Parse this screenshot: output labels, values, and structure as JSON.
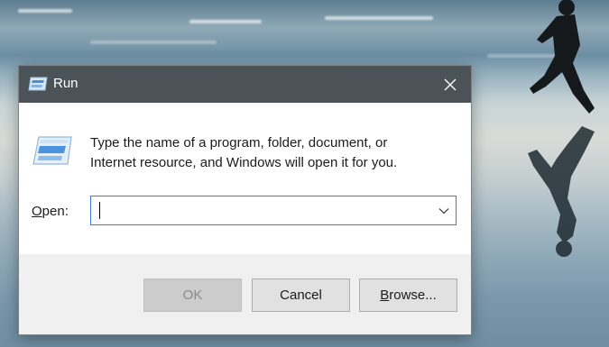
{
  "dialog": {
    "title": "Run",
    "description_line1": "Type the name of a program, folder, document, or",
    "description_line2": "Internet resource, and Windows will open it for you.",
    "open_label_mnemonic": "O",
    "open_label_rest": "pen:",
    "open_value": "",
    "buttons": {
      "ok": "OK",
      "cancel": "Cancel",
      "browse_mnemonic": "B",
      "browse_rest": "rowse..."
    }
  },
  "icons": {
    "title_icon": "run-app-icon",
    "content_icon": "run-app-icon",
    "close": "close-icon",
    "dropdown": "chevron-down-icon"
  },
  "colors": {
    "titlebar": "#4b5359",
    "accent_border": "#3a7bd5",
    "footer": "#f0f0f0"
  }
}
